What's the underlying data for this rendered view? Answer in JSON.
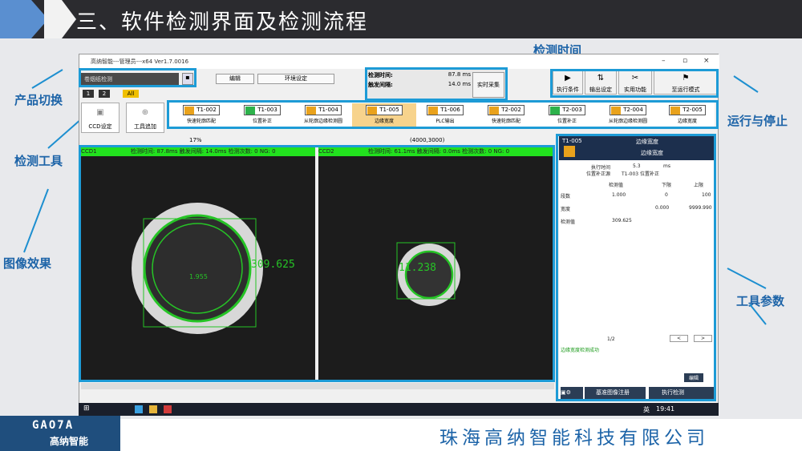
{
  "slide": {
    "title": "三、软件检测界面及检测流程",
    "company": "珠海高纳智能科技有限公司",
    "logo_text": "GAO7A",
    "logo_sub": "高纳智能"
  },
  "labels": {
    "product_switch": "产品切换",
    "detection_time": "检测时间",
    "run_stop": "运行与停止",
    "detection_tools": "检测工具",
    "image_effect": "图像效果",
    "tool_params": "工具参数"
  },
  "window": {
    "title": "高纳智能---管理员---x64 Ver1.7.0016",
    "controls": [
      "–",
      "▫",
      "×"
    ]
  },
  "product": {
    "selected": "卷烟纸检测"
  },
  "menus": {
    "edit": "编辑",
    "env": "环境设定"
  },
  "timing": {
    "detect_label": "检测时间:",
    "detect_value": "87.8 ms",
    "trigger_label": "触发间隔:",
    "trigger_value": "14.0 ms",
    "realtime_btn": "实时采集"
  },
  "toolbar": {
    "exec": "执行条件",
    "output": "输出设定",
    "util": "实用功能",
    "run": "至运行模式"
  },
  "subtabs": {
    "t1": "1",
    "t2": "2",
    "all": "All"
  },
  "ccd": {
    "settings": "CCD设定",
    "add_tool": "工具追加"
  },
  "tools": [
    {
      "id": "T1-002",
      "cap": "快速轮廓匹配",
      "green": false
    },
    {
      "id": "T1-003",
      "cap": "位置补正",
      "green": true
    },
    {
      "id": "T1-004",
      "cap": "从轮廓边缘检测圆",
      "green": false
    },
    {
      "id": "T1-005",
      "cap": "边缘宽度",
      "green": false
    },
    {
      "id": "T1-006",
      "cap": "PLC输出",
      "green": false
    },
    {
      "id": "T2-002",
      "cap": "快速轮廓匹配",
      "green": false
    },
    {
      "id": "T2-003",
      "cap": "位置补正",
      "green": true
    },
    {
      "id": "T2-004",
      "cap": "从轮廓边缘检测圆",
      "green": false
    },
    {
      "id": "T2-005",
      "cap": "边缘宽度",
      "green": false
    }
  ],
  "viewbar": {
    "zoom": "17%",
    "coord": "(4000,3000)"
  },
  "cam1": {
    "name": "CCD1",
    "stats": "检测时间: 87.8ms  触发间隔: 14.0ms  检测次数: 0  NG: 0",
    "measure": "309.625",
    "center": "1.955"
  },
  "cam2": {
    "name": "CCD2",
    "stats": "检测时间: 61.1ms  触发间隔: 0.0ms  检测次数: 0  NG: 0",
    "measure": "11.238"
  },
  "result": {
    "id": "T1-005",
    "name": "边缘宽度",
    "name2": "边缘宽度",
    "exec_label": "执行时间",
    "exec_val": "5.3",
    "exec_unit": "ms",
    "ref_label": "位置补正源",
    "ref_val": "T1-003 位置补正",
    "cols": [
      "检测值",
      "下限",
      "上限"
    ],
    "rows": [
      {
        "name": "段数",
        "v": "1.000",
        "lo": "0",
        "hi": "100"
      },
      {
        "name": "宽度",
        "v": "",
        "lo": "0.000",
        "hi": "9999.990"
      },
      {
        "name": "检测值",
        "v": "309.625",
        "lo": "",
        "hi": ""
      }
    ],
    "page": "1/2",
    "prev": "<",
    "next": ">",
    "log": "边缘宽度检测成功",
    "edit": "编辑",
    "ref_img": "基准图像注册",
    "exec_btn": "执行检测"
  },
  "taskbar": {
    "time": "19:41",
    "lang": "英"
  }
}
